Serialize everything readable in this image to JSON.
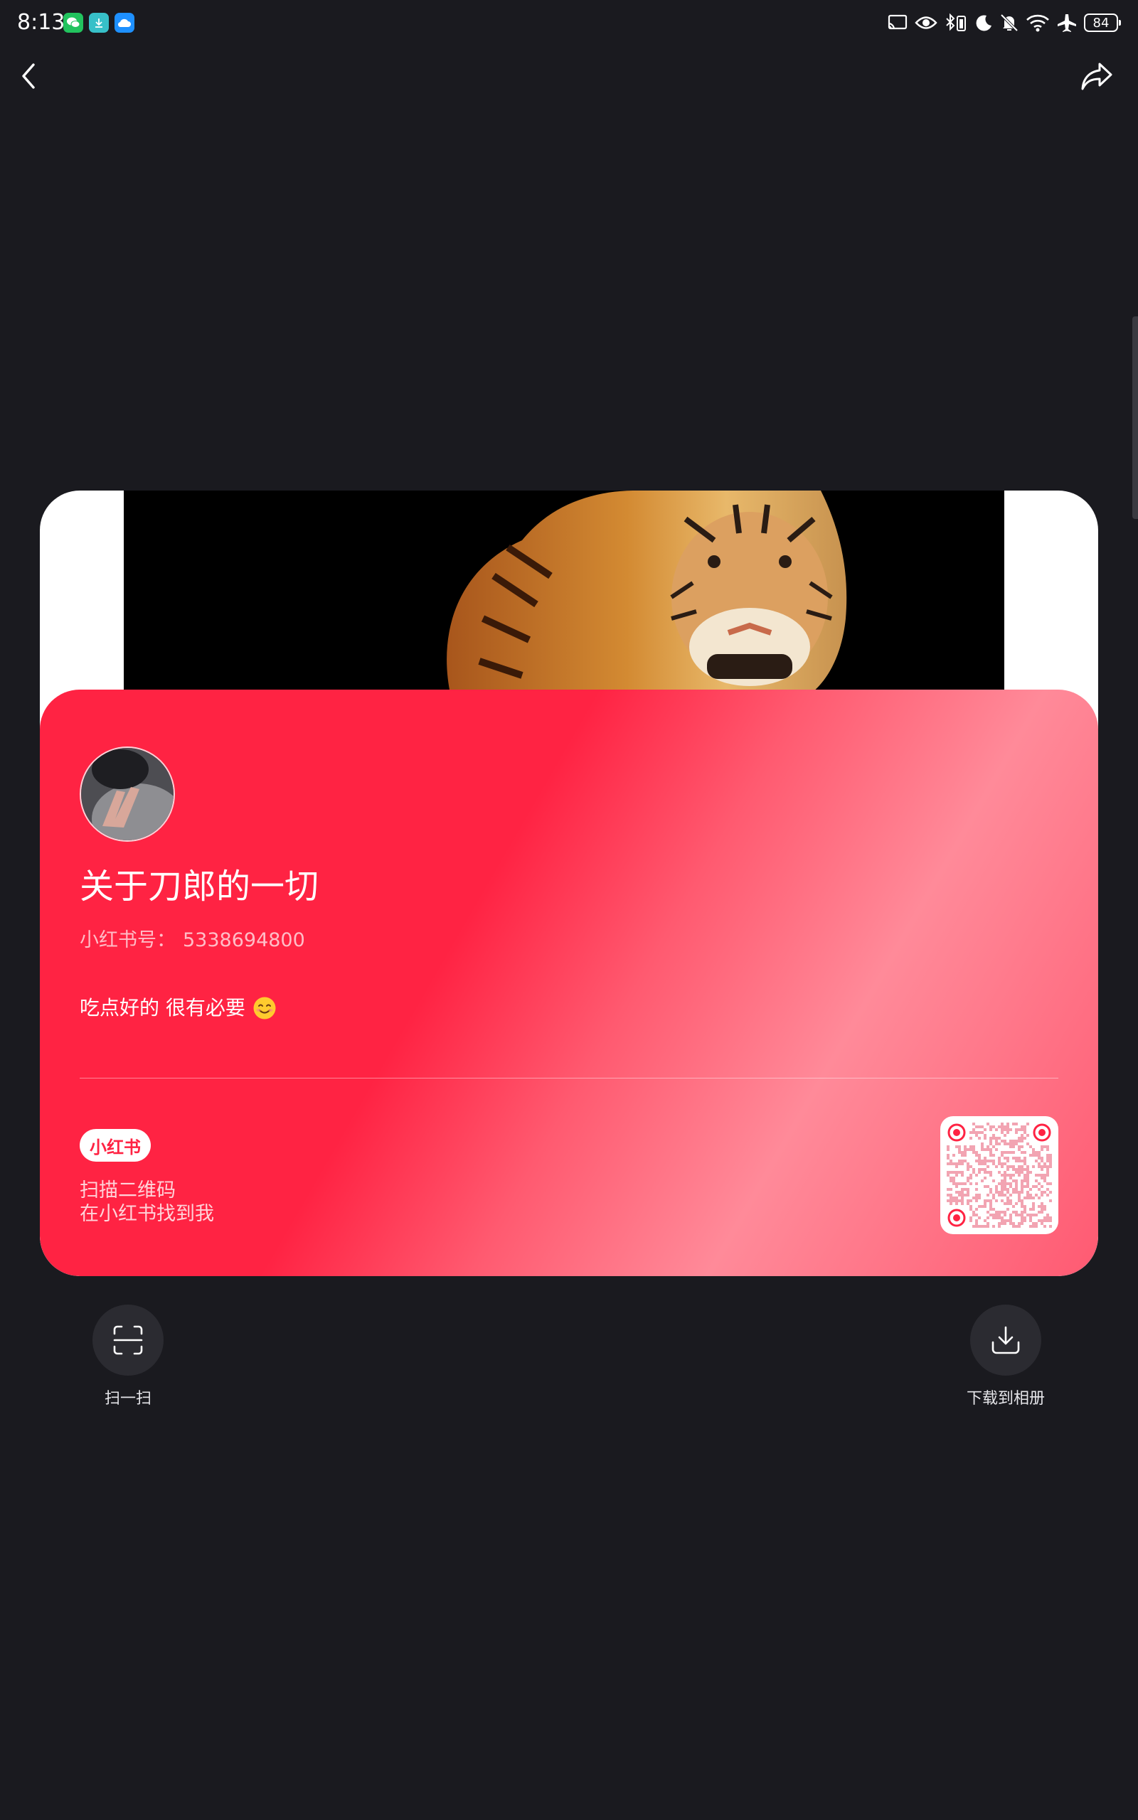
{
  "status_bar": {
    "time": "8:13",
    "battery_level": "84",
    "left_app_icons": [
      "wechat-icon",
      "download-app-icon",
      "cloud-app-icon"
    ],
    "right_icons": [
      "cast-icon",
      "eye-comfort-icon",
      "bluetooth-battery-icon",
      "moon-icon",
      "mute-icon",
      "wifi-icon",
      "airplane-icon",
      "battery-icon"
    ]
  },
  "nav": {
    "back_icon": "chevron-left-icon",
    "share_icon": "share-icon"
  },
  "profile_card": {
    "nickname": "关于刀郎的一切",
    "id_label": "小红书号：",
    "id_value": "5338694800",
    "bio": "吃点好的 很有必要",
    "bio_emoji": "smiling-face-emoji",
    "brand_label": "小红书",
    "scan_tip_line1": "扫描二维码",
    "scan_tip_line2": "在小红书找到我"
  },
  "actions": {
    "scan_label": "扫一扫",
    "download_label": "下载到相册"
  },
  "colors": {
    "background": "#1a1a1f",
    "brand_red": "#ff2343",
    "brand_pink": "#ff8a99",
    "action_circle": "#2b2b31"
  }
}
